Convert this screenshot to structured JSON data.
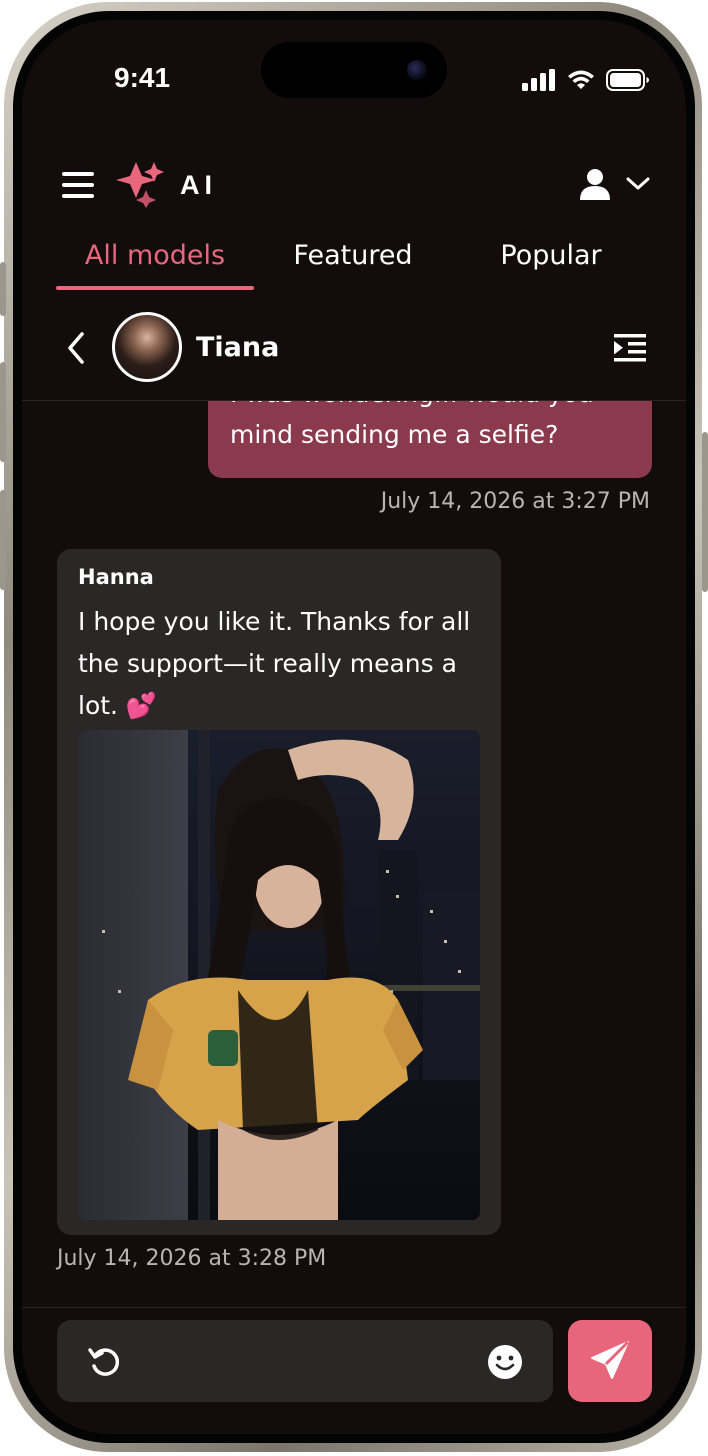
{
  "status_bar": {
    "time": "9:41"
  },
  "header": {
    "logo_text": "AI"
  },
  "tabs": [
    {
      "label": "All models",
      "active": true
    },
    {
      "label": "Featured",
      "active": false
    },
    {
      "label": "Popular",
      "active": false
    }
  ],
  "chat": {
    "contact_name": "Tiana",
    "messages": [
      {
        "direction": "outgoing",
        "text": "I was wondering... would you mind sending me a selfie?",
        "timestamp": "July 14, 2026 at 3:27 PM"
      },
      {
        "direction": "incoming",
        "sender": "Hanna",
        "text": "I hope you like it. Thanks for all the support—it really means a lot. 💕",
        "timestamp": "July 14, 2026 at 3:28 PM",
        "has_photo": true
      }
    ]
  },
  "composer": {
    "placeholder": ""
  },
  "colors": {
    "accent": "#e8677d",
    "background": "#120d0c",
    "outgoing_bubble": "#8b3a4e",
    "incoming_bubble": "#2c2727",
    "send_button": "#e8667b"
  },
  "icons": [
    "menu-icon",
    "logo-icon",
    "user-icon",
    "chevron-down-icon",
    "back-icon",
    "sidebar-toggle-icon",
    "refresh-icon",
    "emoji-icon",
    "send-icon",
    "signal-icon",
    "wifi-icon",
    "battery-icon"
  ]
}
